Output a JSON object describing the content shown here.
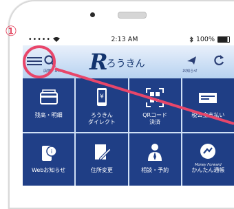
{
  "annotation": {
    "step_number": "①"
  },
  "statusbar": {
    "carrier_dots": "•••••",
    "time": "2:13 AM",
    "battery_text": "100%"
  },
  "header": {
    "search_label": "店舗・ATM",
    "logo_text": "ろうきん",
    "logo_letter": "R",
    "notice_label": "お知らせ"
  },
  "tiles": [
    {
      "label": "残高・明細",
      "icon": "card-icon"
    },
    {
      "label": "ろうきん\nダイレクト",
      "icon": "phone-icon"
    },
    {
      "label": "QRコード\n決済",
      "icon": "qr-icon"
    },
    {
      "label": "税公金支払い",
      "icon": "ticket-icon"
    },
    {
      "label": "Webお知らせ",
      "icon": "web-notice-icon"
    },
    {
      "label": "住所変更",
      "icon": "edit-icon"
    },
    {
      "label": "相談・予約",
      "icon": "consult-icon"
    },
    {
      "label": "かんたん通帳",
      "icon": "money-forward-icon",
      "sub": "Money Forward"
    }
  ],
  "colors": {
    "tile_bg": "#203f87",
    "accent_red": "#e8466a",
    "header_text": "#2a3e74"
  }
}
